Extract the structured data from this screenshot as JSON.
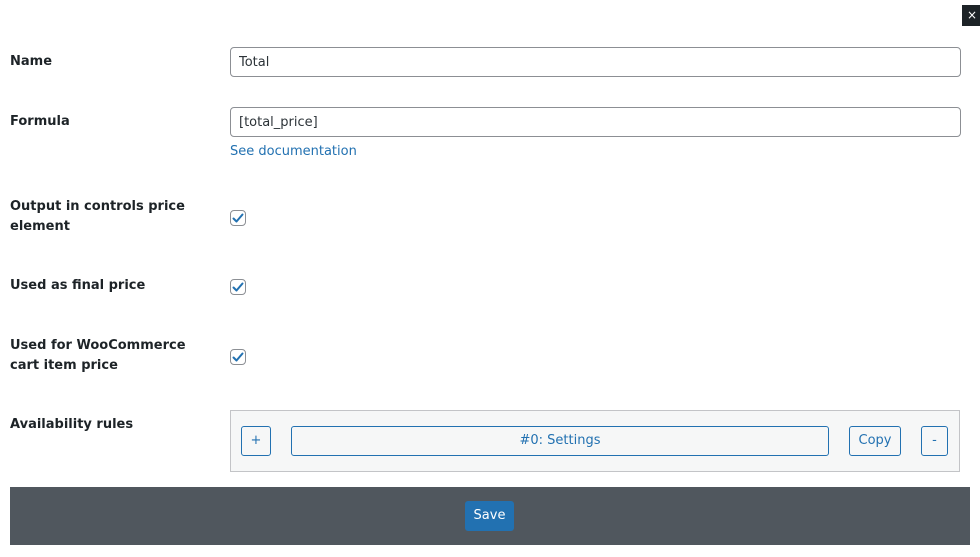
{
  "dialog": {
    "close_label": "×"
  },
  "fields": {
    "name": {
      "label": "Name",
      "value": "Total"
    },
    "formula": {
      "label": "Formula",
      "value": "[total_price]",
      "doc_link": "See documentation"
    },
    "output_in_controls": {
      "label": "Output in controls price element",
      "checked": true
    },
    "final_price": {
      "label": "Used as final price",
      "checked": true
    },
    "cart_item_price": {
      "label": "Used for WooCommerce cart item price",
      "checked": true
    },
    "availability": {
      "label": "Availability rules",
      "add_label": "+",
      "settings_label": "#0: Settings",
      "copy_label": "Copy",
      "remove_label": "-"
    }
  },
  "footer": {
    "save_label": "Save"
  },
  "colors": {
    "accent": "#2271b1",
    "footer_bg": "#50575e",
    "rules_bg": "#f6f7f7"
  }
}
